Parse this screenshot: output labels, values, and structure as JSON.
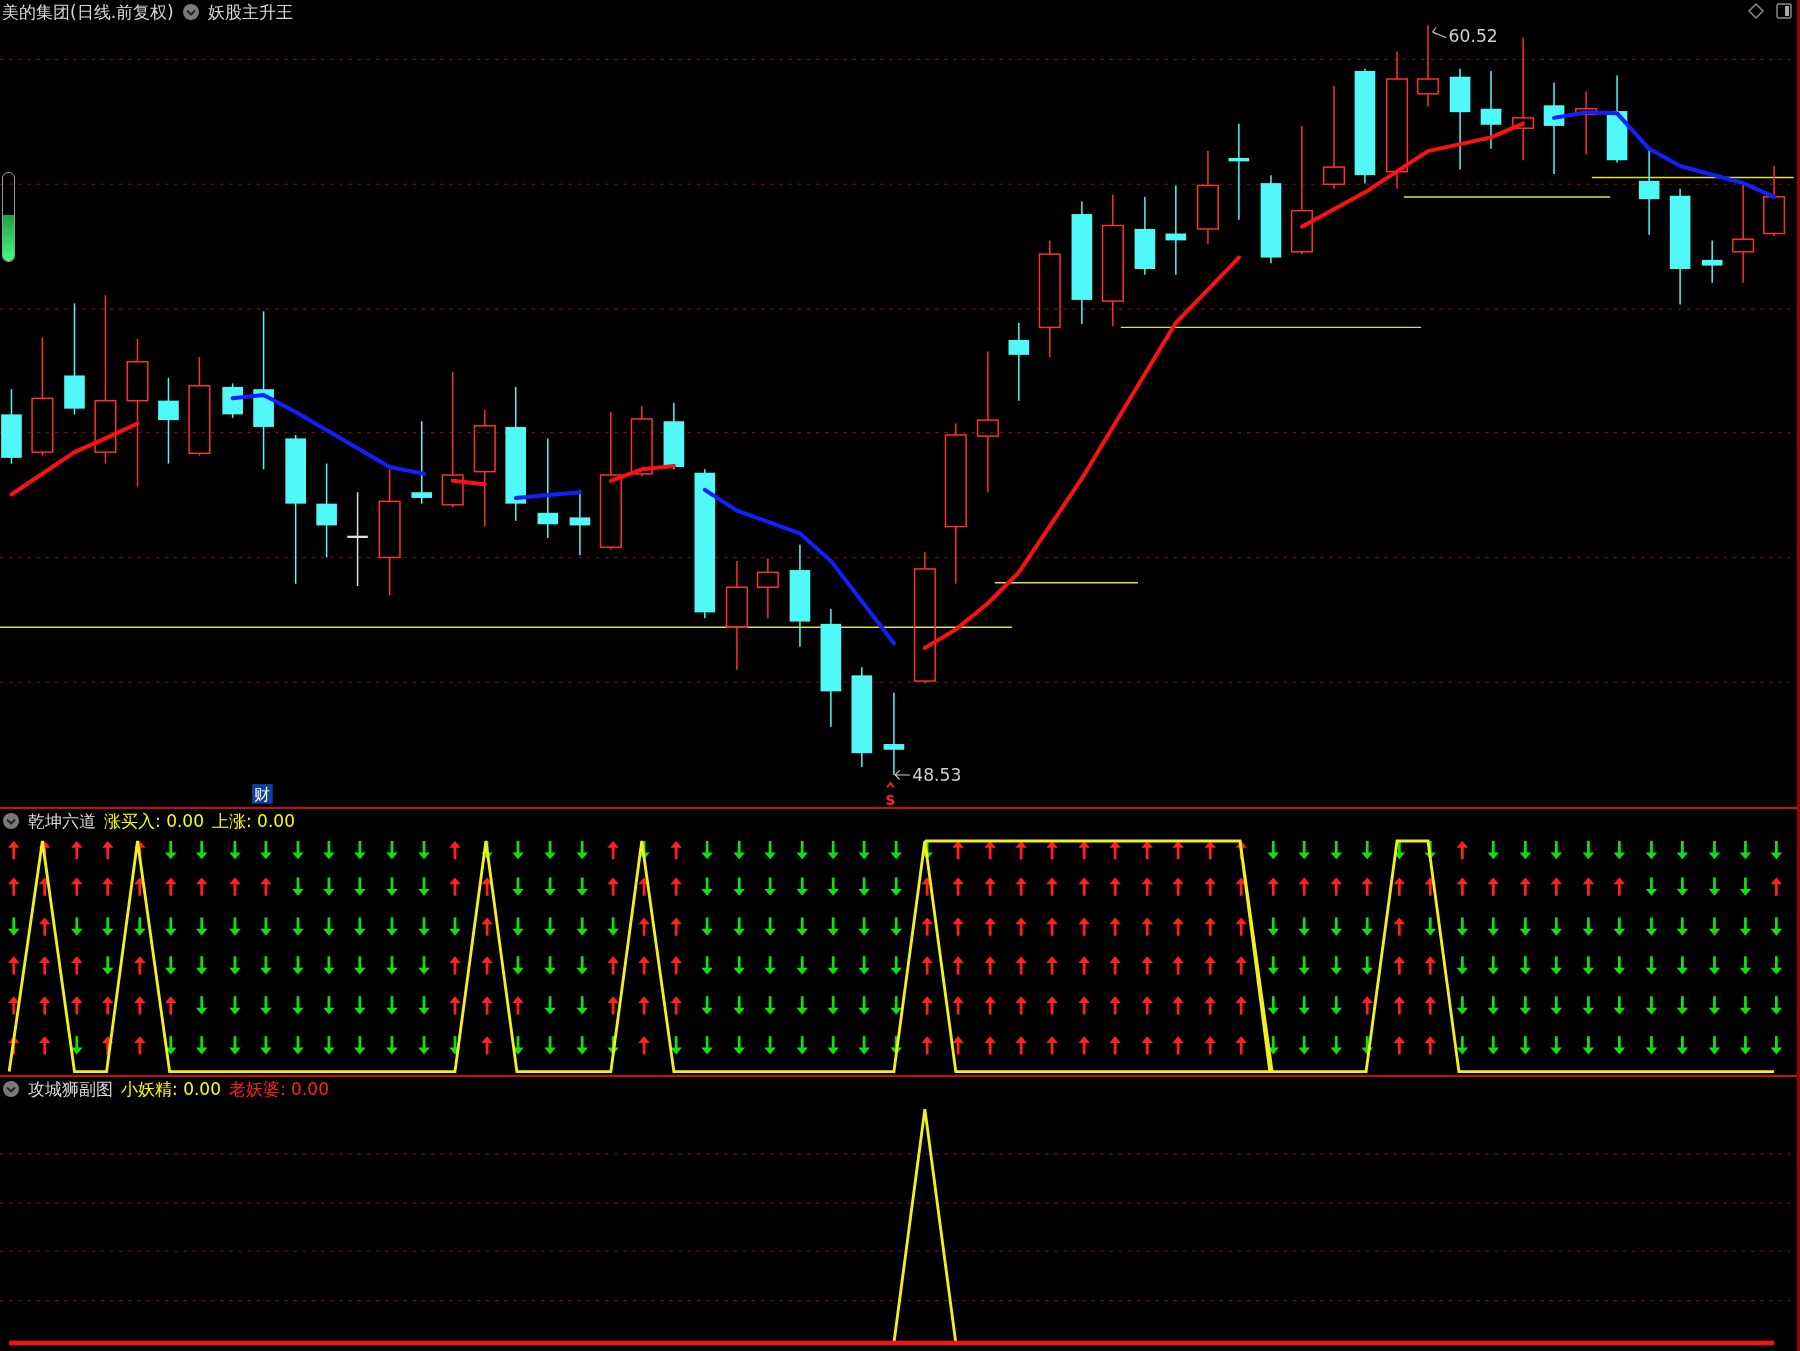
{
  "header": {
    "symbol": "美的集团(日线.前复权)",
    "indicator": "妖股主升王"
  },
  "gauge": {
    "level": 0.52
  },
  "price_labels": {
    "high": "60.52",
    "low": "48.53"
  },
  "markers": [
    {
      "kind": "badge",
      "text": "财"
    },
    {
      "kind": "signal",
      "text": "S"
    }
  ],
  "panels": [
    {
      "title": "乾坤六道",
      "values": [
        {
          "label": "涨买入: 0.00",
          "color": "#ffff00"
        },
        {
          "label": "上涨: 0.00",
          "color": "#ffff00"
        }
      ]
    },
    {
      "title": "攻城狮副图",
      "values": [
        {
          "label": "小妖精: 0.00",
          "color": "#ffff00"
        },
        {
          "label": "老妖婆: 0.00",
          "color": "#ff2020"
        }
      ]
    }
  ]
}
